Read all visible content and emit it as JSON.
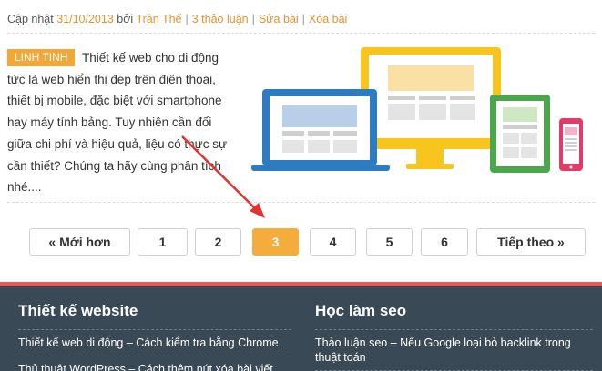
{
  "meta": {
    "updated_label": "Cập nhật",
    "date": "31/10/2013",
    "by_label": "bởi",
    "author": "Trần Thế",
    "comments": "3 thảo luận",
    "edit": "Sửa bài",
    "delete": "Xóa bài"
  },
  "post": {
    "category": "LINH TINH",
    "excerpt": "Thiết kế web cho di động tức là web hiển thị đẹp trên điện thoại, thiết bị mobile, đặc biệt với smartphone hay máy tính bảng. Tuy nhiên cần đối giữa chi phí và hiệu quả, liệu có thực sự cần thiết? Chúng ta hãy cùng phân tích nhé...."
  },
  "pagination": {
    "prev": "« Mới hơn",
    "pages": [
      "1",
      "2",
      "3",
      "4",
      "5",
      "6"
    ],
    "current": "3",
    "next": "Tiếp theo »"
  },
  "footer": {
    "col1": {
      "title": "Thiết kế website",
      "links": [
        "Thiết kế web di động – Cách kiểm tra bằng Chrome",
        "Thủ thuật WordPress – Cách thêm nút xóa bài viết"
      ]
    },
    "col2": {
      "title": "Học làm seo",
      "links": [
        "Thảo luận seo – Nếu Google loại bỏ backlink trong thuật toán",
        ""
      ]
    }
  },
  "colors": {
    "accent": "#f4ad3c",
    "link": "#e8912d",
    "footer_bg": "#3a4956",
    "footer_border": "#e65a5a",
    "arrow": "#e53030"
  }
}
